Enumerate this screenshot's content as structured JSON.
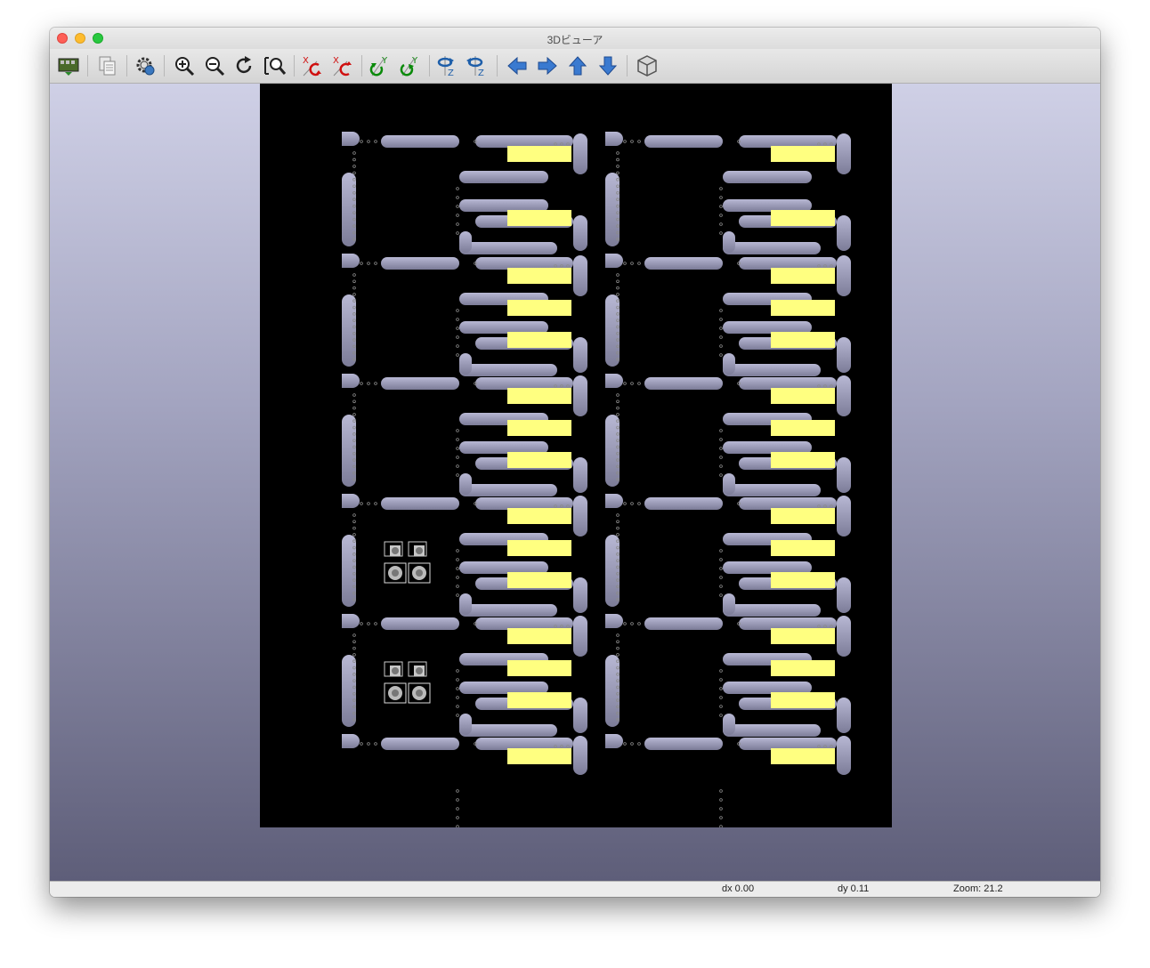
{
  "window": {
    "title": "3Dビューア"
  },
  "toolbar": {
    "buttons": [
      {
        "name": "reload-board-button",
        "icon": "reload-board-icon"
      },
      {
        "name": "copy-image-button",
        "icon": "copy-icon"
      },
      {
        "name": "settings-button",
        "icon": "settings-gear-icon"
      },
      {
        "name": "zoom-in-button",
        "icon": "zoom-in-icon"
      },
      {
        "name": "zoom-out-button",
        "icon": "zoom-out-icon"
      },
      {
        "name": "redraw-button",
        "icon": "redraw-icon"
      },
      {
        "name": "zoom-fit-button",
        "icon": "zoom-fit-icon"
      },
      {
        "name": "rotate-x-cw-button",
        "icon": "rotate-x-cw-icon"
      },
      {
        "name": "rotate-x-ccw-button",
        "icon": "rotate-x-ccw-icon"
      },
      {
        "name": "rotate-y-cw-button",
        "icon": "rotate-y-cw-icon"
      },
      {
        "name": "rotate-y-ccw-button",
        "icon": "rotate-y-ccw-icon"
      },
      {
        "name": "rotate-z-cw-button",
        "icon": "rotate-z-cw-icon"
      },
      {
        "name": "rotate-z-ccw-button",
        "icon": "rotate-z-ccw-icon"
      },
      {
        "name": "pan-left-button",
        "icon": "arrow-left-icon"
      },
      {
        "name": "pan-right-button",
        "icon": "arrow-right-icon"
      },
      {
        "name": "pan-up-button",
        "icon": "arrow-up-icon"
      },
      {
        "name": "pan-down-button",
        "icon": "arrow-down-icon"
      },
      {
        "name": "ortho-view-button",
        "icon": "cube-icon"
      }
    ],
    "axis_letters": {
      "x": "X",
      "y": "Y",
      "z": "Z"
    }
  },
  "colors": {
    "board": "#000000",
    "copper_silk": "#aaaac8",
    "pad_yellow": "#ffff80",
    "icon_red": "#d01010",
    "icon_green": "#0a8a0a",
    "icon_blue": "#1e5faa"
  },
  "status": {
    "dx": "dx 0.00",
    "dy": "dy 0.11",
    "zoom": "Zoom: 21.2"
  }
}
